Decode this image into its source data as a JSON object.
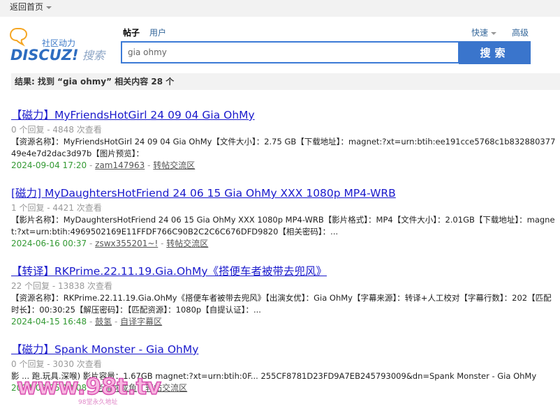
{
  "top": {
    "back_home": "返回首页"
  },
  "logo": {
    "brand": "DISCUZ!",
    "tagline": "社区动力",
    "search_word": "搜索"
  },
  "search": {
    "tabs": [
      {
        "label": "帖子",
        "active": true
      },
      {
        "label": "用户",
        "active": false
      }
    ],
    "quick": "快速",
    "advanced": "高级",
    "query": "gia ohmy",
    "button": "搜索"
  },
  "summary": "结果: 找到 “gia ohmy” 相关内容 28 个",
  "results": [
    {
      "title": "【磁力】MyFriendsHotGirl 24 09 04 Gia OhMy",
      "stats": "0 个回复 - 4848 次查看",
      "snippet": "【资源名称】：MyFriendsHotGirl 24 09 04 Gia OhMy【文件大小】：2.75 GB【下载地址】：magnet:?xt=urn:btih:ee191cce5768c1b83288037749e4e7d2dac3d97b【图片预览】：",
      "date": "2024-09-04 17:20",
      "author": "zam147963",
      "forum": "转帖交流区"
    },
    {
      "title": "[磁力] MyDaughtersHotFriend 24 06 15 Gia OhMy XXX 1080p MP4-WRB",
      "stats": "1 个回复 - 4421 次查看",
      "snippet": "【影片名称】：MyDaughtersHotFriend 24 06 15 Gia OhMy XXX 1080p MP4-WRB【影片格式】：MP4【文件大小】：2.01GB【下载地址】：magnet:?xt=urn:btih:4969502169E11FFDF766C90B2C2C6C676DFD9820【相关密码】：...",
      "date": "2024-06-16 00:37",
      "author": "zswx355201~!",
      "forum": "转帖交流区"
    },
    {
      "title": "【转译】RKPrime.22.11.19.Gia.OhMy《搭便车者被带去兜风》",
      "stats": "22 个回复 - 13838 次查看",
      "snippet": "【资源名称】：RKPrime.22.11.19.Gia.OhMy《搭便车者被带去兜风》【出演女优】：Gia OhMy【字幕来源】：转译+人工校对【字幕行数】：202【匹配时长】：00:30:25【解压密码】：【匹配资源】：1080p【自提认证】：...",
      "date": "2024-04-15 16:48",
      "author": "鼓氢",
      "forum": "自译字幕区"
    },
    {
      "title": "【磁力】Spank Monster - Gia OhMy",
      "stats": "0 个回复 - 3030 次查看",
      "snippet": "影 ... 跑.玩具.深喉) 影片容量：1.67GB magnet:?xt=urn:btih:0F... 255CF8781D23FD9A7EB245793009&dn=Spank Monster - Gia OhMy",
      "date": "2024-02-25 18:08",
      "author": "老猫枕咸鱼",
      "forum": "转帖交流区"
    }
  ],
  "watermark": {
    "text": "www.98t.tv",
    "sub": "98堂永久地址"
  }
}
